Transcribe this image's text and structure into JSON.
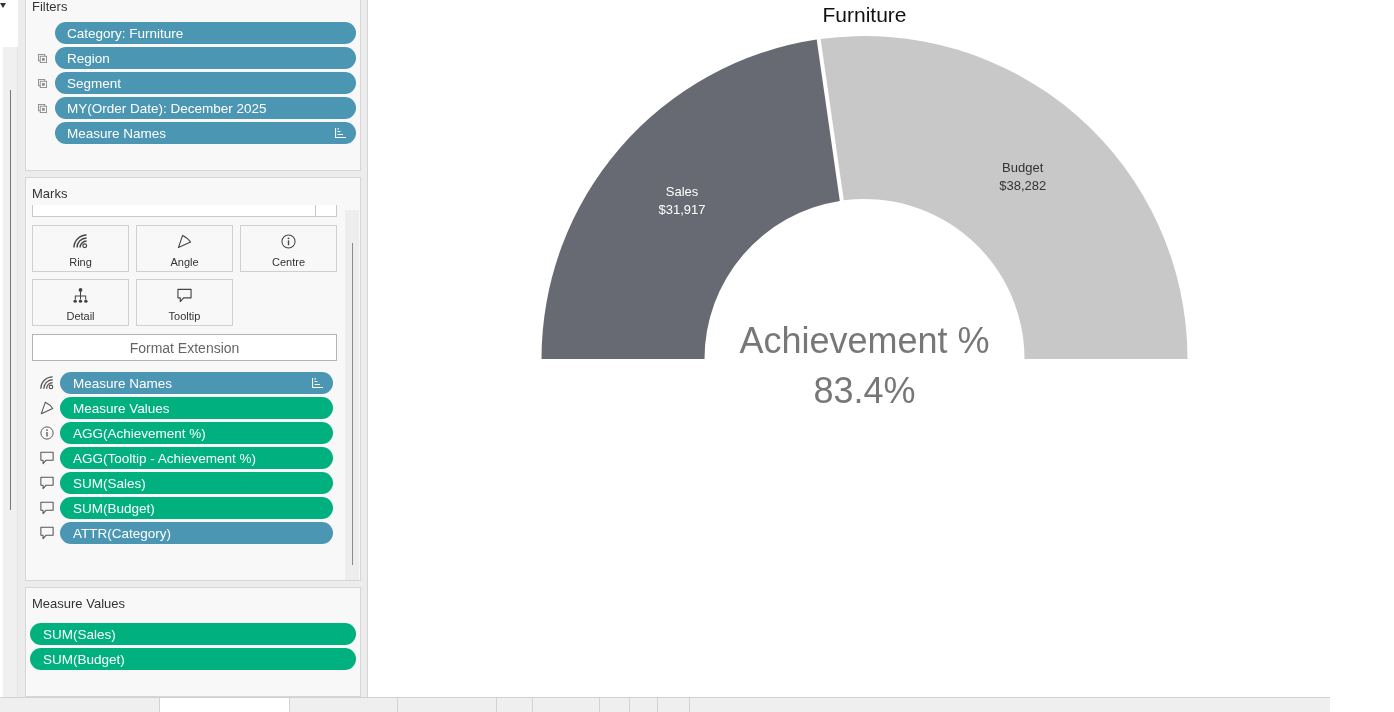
{
  "filters": {
    "title": "Filters",
    "pills": [
      {
        "label": "Category: Furniture",
        "color": "#4b96b3",
        "shared": false,
        "sorted": false
      },
      {
        "label": "Region",
        "color": "#4b96b3",
        "shared": true,
        "sorted": false
      },
      {
        "label": "Segment",
        "color": "#4b96b3",
        "shared": true,
        "sorted": false
      },
      {
        "label": "MY(Order Date): December 2025",
        "color": "#4b96b3",
        "shared": true,
        "sorted": false
      },
      {
        "label": "Measure Names",
        "color": "#4b96b3",
        "shared": false,
        "sorted": true
      }
    ]
  },
  "marks": {
    "title": "Marks",
    "cards": [
      {
        "label": "Ring",
        "kind": "ring"
      },
      {
        "label": "Angle",
        "kind": "angle"
      },
      {
        "label": "Centre",
        "kind": "centre"
      },
      {
        "label": "Detail",
        "kind": "detail"
      },
      {
        "label": "Tooltip",
        "kind": "tooltip"
      }
    ],
    "format_button": "Format Extension",
    "pills": [
      {
        "label": "Measure Names",
        "color": "#4b96b3",
        "kind": "ring",
        "sorted": true
      },
      {
        "label": "Measure Values",
        "color": "#00b17f",
        "kind": "angle",
        "sorted": false
      },
      {
        "label": "AGG(Achievement %)",
        "color": "#00b17f",
        "kind": "centre",
        "sorted": false
      },
      {
        "label": "AGG(Tooltip - Achievement %)",
        "color": "#00b17f",
        "kind": "tooltip",
        "sorted": false
      },
      {
        "label": "SUM(Sales)",
        "color": "#00b17f",
        "kind": "tooltip",
        "sorted": false
      },
      {
        "label": "SUM(Budget)",
        "color": "#00b17f",
        "kind": "tooltip",
        "sorted": false
      },
      {
        "label": "ATTR(Category)",
        "color": "#4b96b3",
        "kind": "tooltip",
        "sorted": false
      }
    ]
  },
  "measure_values": {
    "title": "Measure Values",
    "pills": [
      {
        "label": "SUM(Sales)",
        "color": "#00b17f"
      },
      {
        "label": "SUM(Budget)",
        "color": "#00b17f"
      }
    ]
  },
  "chart": {
    "center_label": "Achievement %",
    "center_value": "83.4%",
    "chart_data": {
      "type": "donut",
      "title": "Furniture",
      "categories": [
        "Sales",
        "Budget"
      ],
      "values": [
        31917,
        38282
      ],
      "colors": [
        "#676a72",
        "#c8c8c8"
      ],
      "value_labels": [
        "$31,917",
        "$38,282"
      ]
    }
  },
  "sheet_tabs": [
    {
      "selected": false
    },
    {
      "selected": true
    },
    {
      "selected": false
    },
    {
      "selected": false
    },
    {
      "selected": false
    },
    {
      "selected": false
    },
    {
      "selected": false
    },
    {
      "selected": false
    },
    {
      "selected": false
    }
  ]
}
